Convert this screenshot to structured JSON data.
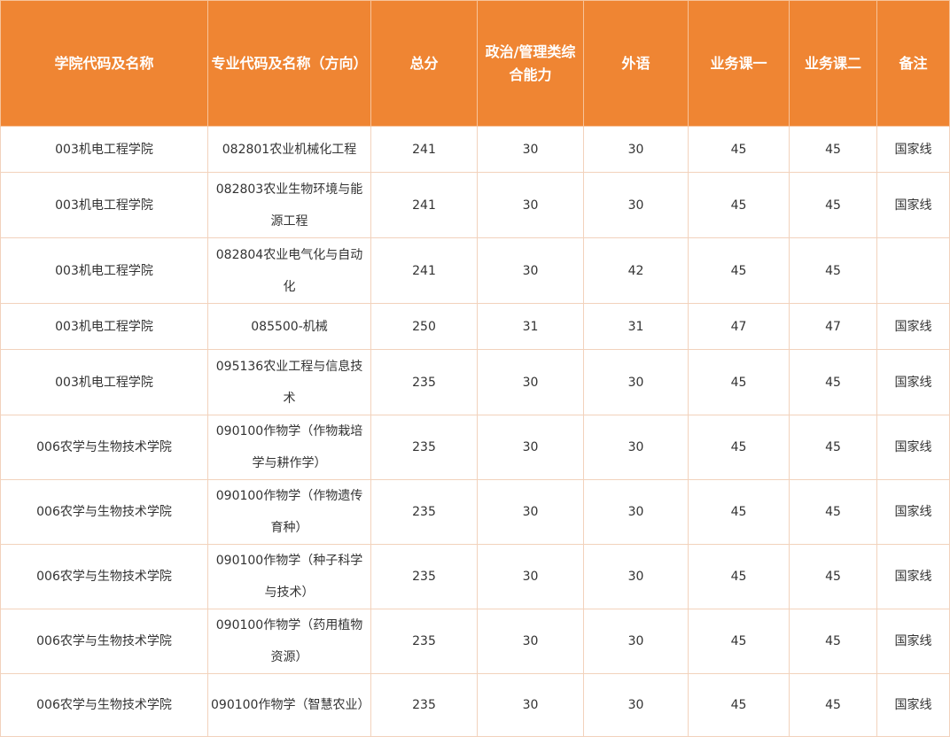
{
  "table": {
    "headers": [
      "学院代码及名称",
      "专业代码及名称（方向）",
      "总分",
      "政治/管理类综合能力",
      "外语",
      "业务课一",
      "业务课二",
      "备注"
    ],
    "rows": [
      [
        "003机电工程学院",
        "082801农业机械化工程",
        "241",
        "30",
        "30",
        "45",
        "45",
        "国家线"
      ],
      [
        "003机电工程学院",
        "082803农业生物环境与能源工程",
        "241",
        "30",
        "30",
        "45",
        "45",
        "国家线"
      ],
      [
        "003机电工程学院",
        "082804农业电气化与自动化",
        "241",
        "30",
        "42",
        "45",
        "45",
        ""
      ],
      [
        "003机电工程学院",
        "085500-机械",
        "250",
        "31",
        "31",
        "47",
        "47",
        "国家线"
      ],
      [
        "003机电工程学院",
        "095136农业工程与信息技术",
        "235",
        "30",
        "30",
        "45",
        "45",
        "国家线"
      ],
      [
        "006农学与生物技术学院",
        "090100作物学（作物栽培学与耕作学）",
        "235",
        "30",
        "30",
        "45",
        "45",
        "国家线"
      ],
      [
        "006农学与生物技术学院",
        "090100作物学（作物遗传育种）",
        "235",
        "30",
        "30",
        "45",
        "45",
        "国家线"
      ],
      [
        "006农学与生物技术学院",
        "090100作物学（种子科学与技术）",
        "235",
        "30",
        "30",
        "45",
        "45",
        "国家线"
      ],
      [
        "006农学与生物技术学院",
        "090100作物学（药用植物资源）",
        "235",
        "30",
        "30",
        "45",
        "45",
        "国家线"
      ],
      [
        "006农学与生物技术学院",
        "090100作物学（智慧农业）",
        "235",
        "30",
        "30",
        "45",
        "45",
        "国家线"
      ]
    ]
  },
  "colors": {
    "header_bg": "#ef8533",
    "header_text": "#ffffff",
    "border": "#f2d2bc",
    "body_text": "#333333"
  }
}
